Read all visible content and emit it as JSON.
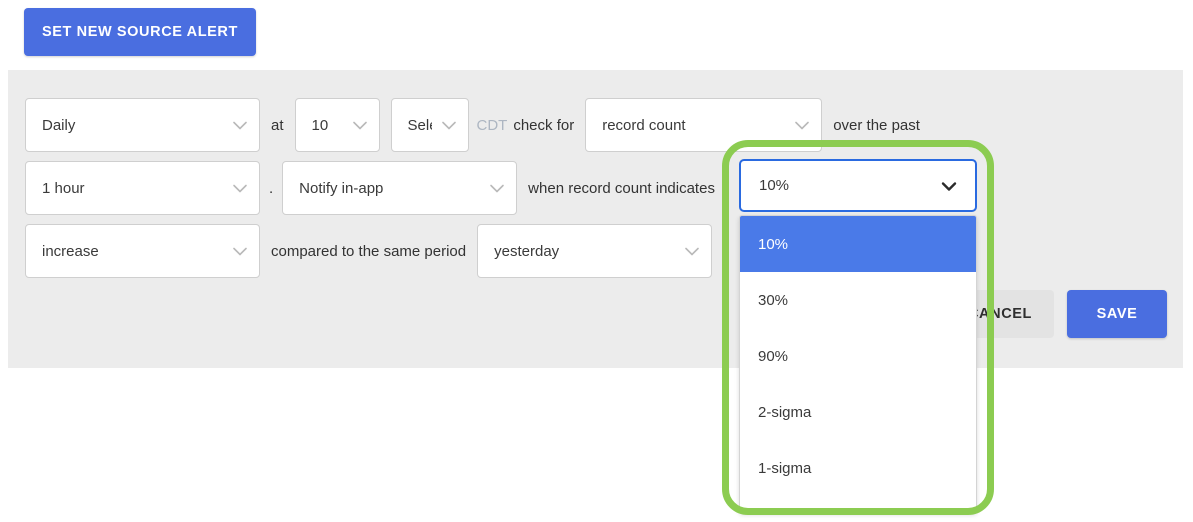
{
  "top": {
    "set_alert_label": "SET NEW SOURCE ALERT"
  },
  "form": {
    "row1": {
      "frequency_value": "Daily",
      "at_label": "at",
      "hour_value": "10",
      "minute_value": "Sele",
      "timezone_label": "CDT",
      "check_for_label": "check for",
      "metric_value": "record count",
      "over_the_past_label": "over the past"
    },
    "row2": {
      "period_value": "1 hour",
      "dot_label": ".",
      "notify_value": "Notify in-app",
      "when_label": "when record count indicates"
    },
    "row3": {
      "direction_value": "increase",
      "compared_label": "compared to the same period",
      "compare_value": "yesterday",
      "trailing_dot": "."
    }
  },
  "threshold_dropdown": {
    "selected_value": "10%",
    "options": [
      {
        "label": "10%",
        "selected": true
      },
      {
        "label": "30%",
        "selected": false
      },
      {
        "label": "90%",
        "selected": false
      },
      {
        "label": "2-sigma",
        "selected": false
      },
      {
        "label": "1-sigma",
        "selected": false
      }
    ]
  },
  "actions": {
    "cancel_label": "CANCEL",
    "save_label": "SAVE"
  },
  "colors": {
    "primary_blue": "#4a6ee0",
    "highlight_green": "#8ccc51",
    "panel_gray": "#ececec",
    "option_selected_blue": "#4a7ae8",
    "focus_border_blue": "#2a6ae0",
    "timezone_gray": "#adb6c2"
  },
  "icons": {
    "chevron_down": "chevron-down-icon"
  }
}
